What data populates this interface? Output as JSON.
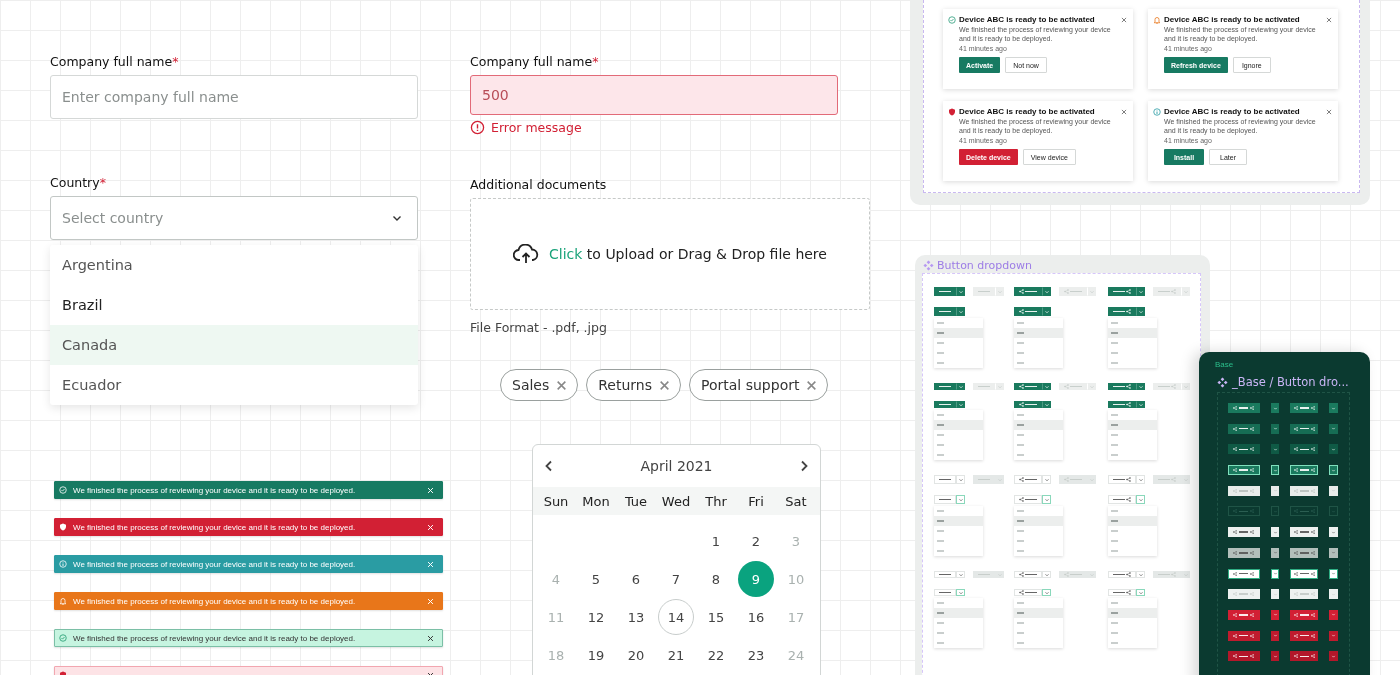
{
  "form": {
    "company_name": {
      "label": "Company full name",
      "required_mark": "*",
      "placeholder": "Enter company full name"
    },
    "company_name_error": {
      "label": "Company full name",
      "required_mark": "*",
      "value": "500",
      "invalid": true,
      "error": "Error message"
    },
    "country": {
      "label": "Country",
      "required_mark": "*",
      "placeholder": "Select country",
      "expanded": true,
      "options": [
        {
          "label": "Argentina",
          "selected": false,
          "hovered": false
        },
        {
          "label": "Brazil",
          "selected": false,
          "hovered": true
        },
        {
          "label": "Canada",
          "selected": true,
          "hovered": false
        },
        {
          "label": "Ecuador",
          "selected": false,
          "hovered": false
        }
      ]
    },
    "upload": {
      "label": "Additional documents",
      "link": "Click",
      "text": "to Upload or Drag & Drop file here",
      "hint": "File Format - .pdf, .jpg"
    },
    "tags": [
      {
        "label": "Sales"
      },
      {
        "label": "Returns"
      },
      {
        "label": "Portal support"
      }
    ]
  },
  "calendar": {
    "title": "April 2021",
    "weekdays": [
      "Sun",
      "Mon",
      "Tue",
      "Wed",
      "Thr",
      "Fri",
      "Sat"
    ],
    "weeks": [
      [
        {
          "kind": "blank"
        },
        {
          "kind": "blank"
        },
        {
          "kind": "blank"
        },
        {
          "kind": "blank"
        },
        {
          "kind": "day",
          "day": "1",
          "muted": false,
          "selected": false,
          "today": false
        },
        {
          "kind": "day",
          "day": "2",
          "muted": false,
          "selected": false,
          "today": false
        },
        {
          "kind": "day",
          "day": "3",
          "muted": true,
          "selected": false,
          "today": false
        }
      ],
      [
        {
          "kind": "day",
          "day": "4",
          "muted": true,
          "selected": false,
          "today": false
        },
        {
          "kind": "day",
          "day": "5",
          "muted": false,
          "selected": false,
          "today": false
        },
        {
          "kind": "day",
          "day": "6",
          "muted": false,
          "selected": false,
          "today": false
        },
        {
          "kind": "day",
          "day": "7",
          "muted": false,
          "selected": false,
          "today": false
        },
        {
          "kind": "day",
          "day": "8",
          "muted": false,
          "selected": false,
          "today": false
        },
        {
          "kind": "day",
          "day": "9",
          "muted": false,
          "selected": true,
          "today": false
        },
        {
          "kind": "day",
          "day": "10",
          "muted": true,
          "selected": false,
          "today": false
        }
      ],
      [
        {
          "kind": "day",
          "day": "11",
          "muted": true,
          "selected": false,
          "today": false
        },
        {
          "kind": "day",
          "day": "12",
          "muted": false,
          "selected": false,
          "today": false
        },
        {
          "kind": "day",
          "day": "13",
          "muted": false,
          "selected": false,
          "today": false
        },
        {
          "kind": "day",
          "day": "14",
          "muted": false,
          "selected": false,
          "today": true
        },
        {
          "kind": "day",
          "day": "15",
          "muted": false,
          "selected": false,
          "today": false
        },
        {
          "kind": "day",
          "day": "16",
          "muted": false,
          "selected": false,
          "today": false
        },
        {
          "kind": "day",
          "day": "17",
          "muted": true,
          "selected": false,
          "today": false
        }
      ],
      [
        {
          "kind": "day",
          "day": "18",
          "muted": true,
          "selected": false,
          "today": false
        },
        {
          "kind": "day",
          "day": "19",
          "muted": false,
          "selected": false,
          "today": false
        },
        {
          "kind": "day",
          "day": "20",
          "muted": false,
          "selected": false,
          "today": false
        },
        {
          "kind": "day",
          "day": "21",
          "muted": false,
          "selected": false,
          "today": false
        },
        {
          "kind": "day",
          "day": "22",
          "muted": false,
          "selected": false,
          "today": false
        },
        {
          "kind": "day",
          "day": "23",
          "muted": false,
          "selected": false,
          "today": false
        },
        {
          "kind": "day",
          "day": "24",
          "muted": true,
          "selected": false,
          "today": false
        }
      ]
    ]
  },
  "banners": [
    {
      "kind": "success",
      "text": "We finished the process of reviewing your device and it is ready to be deployed."
    },
    {
      "kind": "error",
      "text": "We finished the process of reviewing your device and it is ready to be deployed."
    },
    {
      "kind": "info",
      "text": "We finished the process of reviewing your device and it is ready to be deployed."
    },
    {
      "kind": "warning",
      "text": "We finished the process of reviewing your device and it is ready to be deployed."
    },
    {
      "kind": "success-light",
      "text": "We finished the process of reviewing your device and it is ready to be deployed."
    },
    {
      "kind": "error-light"
    }
  ],
  "notifications": [
    {
      "kind": "success",
      "title": "Device ABC is ready to be activated",
      "body": "We finished the process of reviewing your device and it is ready to be deployed.",
      "time": "41 minutes ago",
      "primary": "Activate",
      "secondary": "Not now"
    },
    {
      "kind": "warning",
      "title": "Device ABC is ready to be activated",
      "body": "We finished the process of reviewing your device and it is ready to be deployed.",
      "time": "41 minutes ago",
      "primary": "Refresh device",
      "secondary": "Ignore"
    },
    {
      "kind": "error",
      "title": "Device ABC is ready to be activated",
      "body": "We finished the process of reviewing your device and it is ready to be deployed.",
      "time": "41 minutes ago",
      "primary": "Delete device",
      "secondary": "View device"
    },
    {
      "kind": "info",
      "title": "Device ABC is ready to be activated",
      "body": "We finished the process of reviewing your device and it is ready to be deployed.",
      "time": "41 minutes ago",
      "primary": "Install",
      "secondary": "Later"
    }
  ],
  "button_dropdown": {
    "title": "Button dropdown",
    "sections": [
      {
        "kind": "filled-large",
        "buttons": [
          {
            "kind": "plain",
            "disabled": false
          },
          {
            "kind": "plain",
            "disabled": true
          },
          {
            "kind": "leading",
            "disabled": false
          },
          {
            "kind": "leading",
            "disabled": true
          },
          {
            "kind": "trailing",
            "disabled": false
          },
          {
            "kind": "trailing",
            "disabled": true
          }
        ],
        "open": [
          {
            "kind": "plain",
            "items": [
              {
                "selected": false
              },
              {
                "selected": true
              },
              {
                "selected": false
              },
              {
                "selected": false
              },
              {
                "selected": false
              }
            ]
          },
          {
            "kind": "leading",
            "items": [
              {
                "selected": false
              },
              {
                "selected": true
              },
              {
                "selected": false
              },
              {
                "selected": false
              },
              {
                "selected": false
              }
            ]
          },
          {
            "kind": "trailing",
            "items": [
              {
                "selected": false
              },
              {
                "selected": true
              },
              {
                "selected": false
              },
              {
                "selected": false
              },
              {
                "selected": false
              }
            ]
          }
        ]
      },
      {
        "kind": "filled-small",
        "buttons": [
          {
            "kind": "plain",
            "disabled": false
          },
          {
            "kind": "plain",
            "disabled": true
          },
          {
            "kind": "leading",
            "disabled": false
          },
          {
            "kind": "leading",
            "disabled": true
          },
          {
            "kind": "trailing",
            "disabled": false
          },
          {
            "kind": "trailing",
            "disabled": true
          }
        ],
        "open": [
          {
            "kind": "plain",
            "items": [
              {
                "selected": false
              },
              {
                "selected": true
              },
              {
                "selected": false
              },
              {
                "selected": false
              },
              {
                "selected": false
              }
            ]
          },
          {
            "kind": "leading",
            "items": [
              {
                "selected": false
              },
              {
                "selected": true
              },
              {
                "selected": false
              },
              {
                "selected": false
              },
              {
                "selected": false
              }
            ]
          },
          {
            "kind": "trailing",
            "items": [
              {
                "selected": false
              },
              {
                "selected": true
              },
              {
                "selected": false
              },
              {
                "selected": false
              },
              {
                "selected": false
              }
            ]
          }
        ]
      },
      {
        "kind": "outline-large",
        "buttons": [
          {
            "kind": "plain",
            "disabled": false
          },
          {
            "kind": "plain",
            "disabled": true
          },
          {
            "kind": "leading",
            "disabled": false
          },
          {
            "kind": "leading",
            "disabled": true
          },
          {
            "kind": "trailing",
            "disabled": false
          },
          {
            "kind": "trailing",
            "disabled": true
          }
        ],
        "open": [
          {
            "kind": "plain",
            "items": [
              {
                "selected": false
              },
              {
                "selected": true
              },
              {
                "selected": false
              },
              {
                "selected": false
              },
              {
                "selected": false
              }
            ]
          },
          {
            "kind": "leading",
            "items": [
              {
                "selected": false
              },
              {
                "selected": true
              },
              {
                "selected": false
              },
              {
                "selected": false
              },
              {
                "selected": false
              }
            ]
          },
          {
            "kind": "trailing",
            "items": [
              {
                "selected": false
              },
              {
                "selected": true
              },
              {
                "selected": false
              },
              {
                "selected": false
              },
              {
                "selected": false
              }
            ]
          }
        ]
      },
      {
        "kind": "outline-small",
        "buttons": [
          {
            "kind": "plain",
            "disabled": false
          },
          {
            "kind": "plain",
            "disabled": true
          },
          {
            "kind": "leading",
            "disabled": false
          },
          {
            "kind": "leading",
            "disabled": true
          },
          {
            "kind": "trailing",
            "disabled": false
          },
          {
            "kind": "trailing",
            "disabled": true
          }
        ],
        "open": [
          {
            "kind": "plain",
            "items": [
              {
                "selected": false
              },
              {
                "selected": true
              },
              {
                "selected": false
              },
              {
                "selected": false
              },
              {
                "selected": false
              }
            ]
          },
          {
            "kind": "leading",
            "items": [
              {
                "selected": false
              },
              {
                "selected": true
              },
              {
                "selected": false
              },
              {
                "selected": false
              },
              {
                "selected": false
              }
            ]
          },
          {
            "kind": "trailing",
            "items": [
              {
                "selected": false
              },
              {
                "selected": true
              },
              {
                "selected": false
              },
              {
                "selected": false
              },
              {
                "selected": false
              }
            ]
          }
        ]
      }
    ]
  },
  "base_panel": {
    "caption": "Base",
    "title": "_Base / Button dro...",
    "rows": [
      {
        "kind": "primary"
      },
      {
        "kind": "primary-hover"
      },
      {
        "kind": "primary-pressed"
      },
      {
        "kind": "primary-focus"
      },
      {
        "kind": "light-disabled"
      },
      {
        "kind": "ghost"
      },
      {
        "kind": "light"
      },
      {
        "kind": "gray"
      },
      {
        "kind": "white-focus"
      },
      {
        "kind": "white-disabled"
      },
      {
        "kind": "danger"
      },
      {
        "kind": "danger-hover"
      },
      {
        "kind": "danger-pressed"
      }
    ]
  }
}
